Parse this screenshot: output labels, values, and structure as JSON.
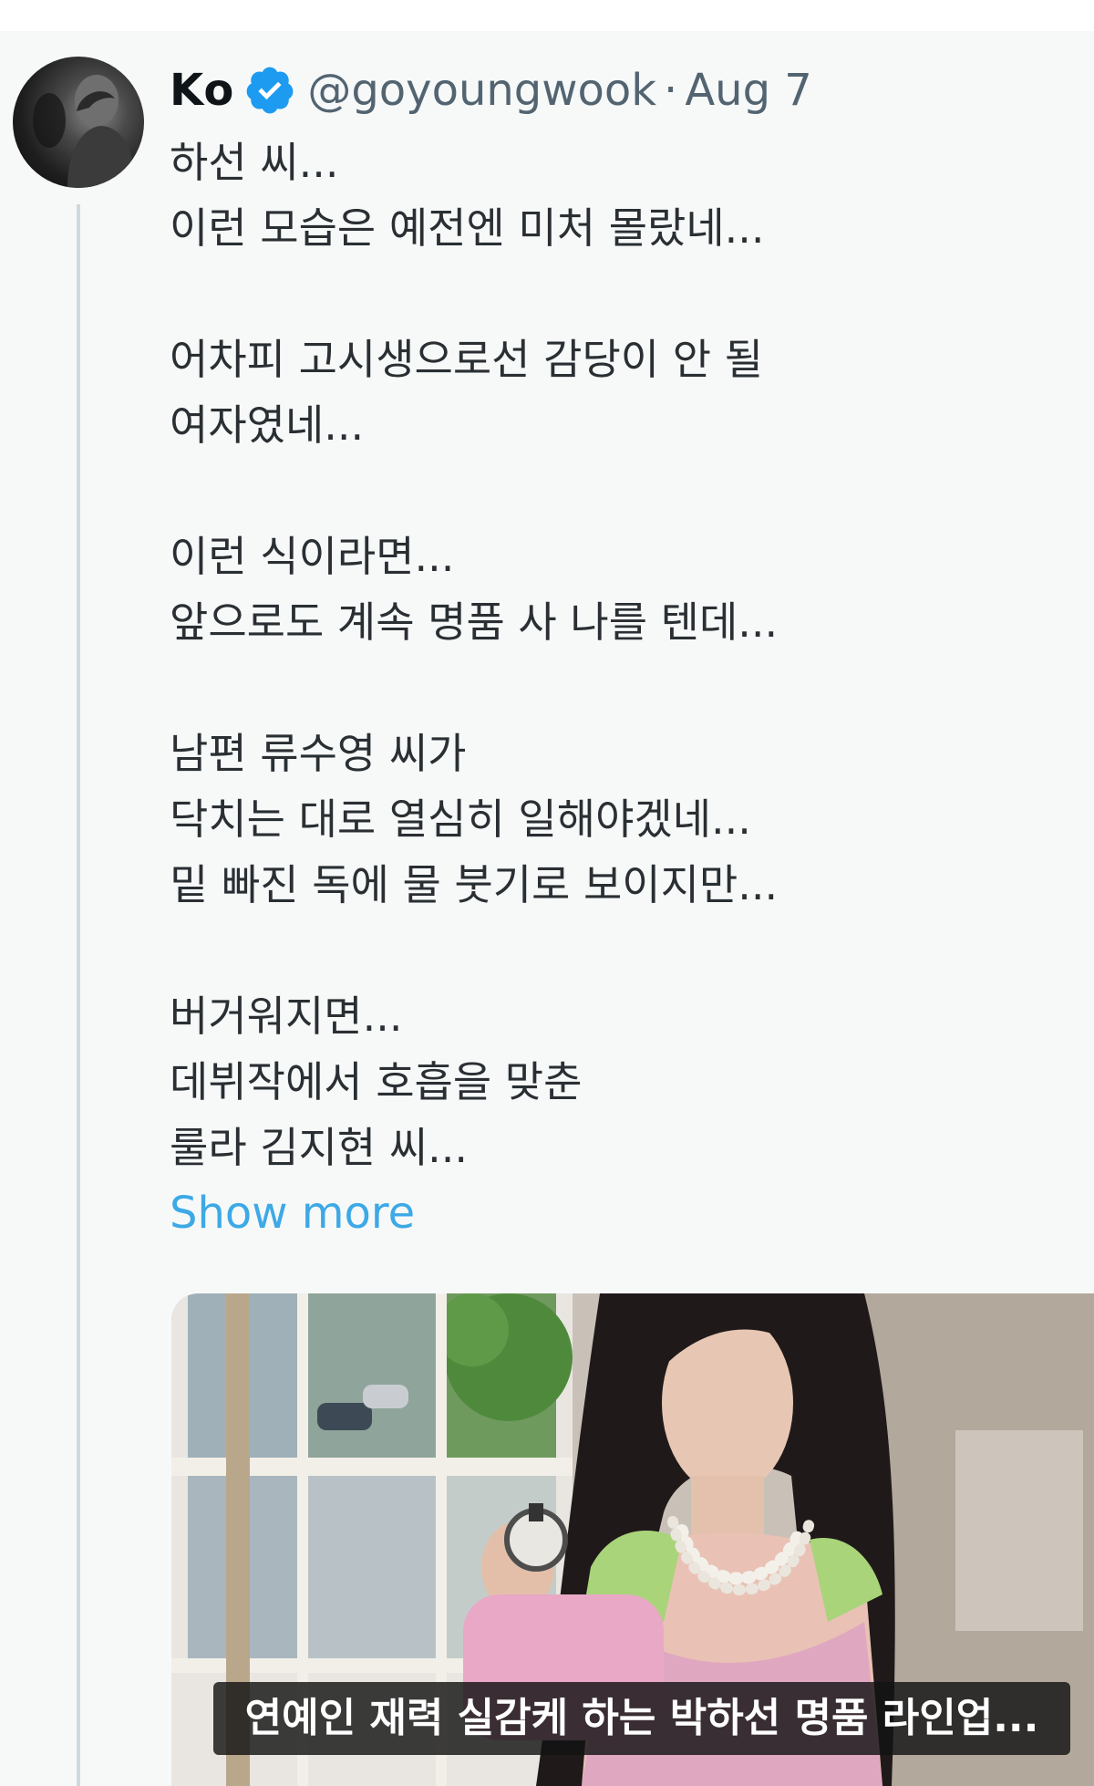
{
  "tweet": {
    "author": {
      "display_name": "Ko",
      "handle": "@goyoungwook",
      "verified": true
    },
    "separator": "·",
    "date": "Aug 7",
    "lines": [
      "하선 씨...",
      "이런 모습은 예전엔 미처 몰랐네...",
      "",
      "어차피 고시생으로선 감당이 안 될",
      "여자였네...",
      "",
      "이런 식이라면...",
      "앞으로도 계속 명품 사 나를 텐데...",
      "",
      "남편 류수영 씨가",
      "닥치는 대로 열심히 일해야겠네...",
      "밑 빠진 독에 물 붓기로 보이지만...",
      "",
      "버거워지면...",
      "데뷔작에서 호흡을 맞춘",
      "룰라 김지현 씨..."
    ],
    "show_more": "Show more",
    "media": {
      "caption": "연예인 재력 실감케 하는 박하선 명품 라인업..."
    }
  },
  "colors": {
    "card_background": "#f7f9f9",
    "verified": "#1d9bf0",
    "link": "#3da9e6",
    "secondary_text": "#536471",
    "thread_line": "#cfd9de"
  },
  "icons": {
    "verified": "verified-badge-icon"
  }
}
